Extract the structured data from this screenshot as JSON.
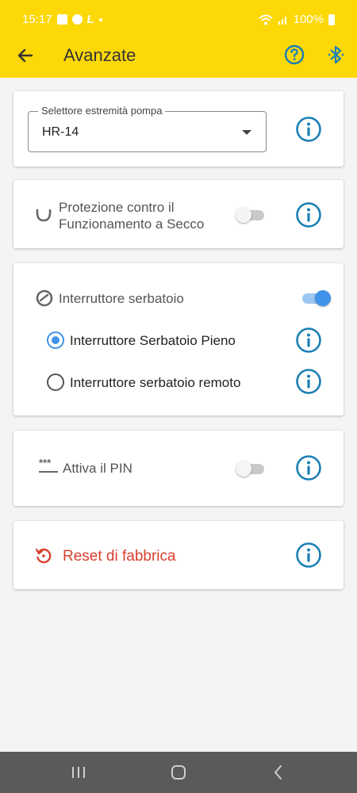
{
  "status_bar": {
    "time": "15:17",
    "battery": "100%"
  },
  "app_bar": {
    "title": "Avanzate"
  },
  "pump_selector": {
    "legend": "Selettore estremità pompa",
    "value": "HR-14"
  },
  "dry_run": {
    "label_line1": "Protezione contro il",
    "label_line2": "Funzionamento a Secco",
    "enabled": false
  },
  "tank_switch": {
    "label": "Interruttore serbatoio",
    "enabled": true,
    "options": [
      {
        "label": "Interruttore Serbatoio Pieno",
        "selected": true
      },
      {
        "label": "Interruttore serbatoio remoto",
        "selected": false
      }
    ]
  },
  "pin": {
    "icon_text": "***",
    "label": "Attiva il PIN",
    "enabled": false
  },
  "factory_reset": {
    "label": "Reset di fabbrica"
  },
  "colors": {
    "accent_yellow": "#fdd807",
    "info_blue": "#1a7fb5",
    "toggle_blue": "#3f93e8",
    "reset_red": "#d9402f"
  }
}
